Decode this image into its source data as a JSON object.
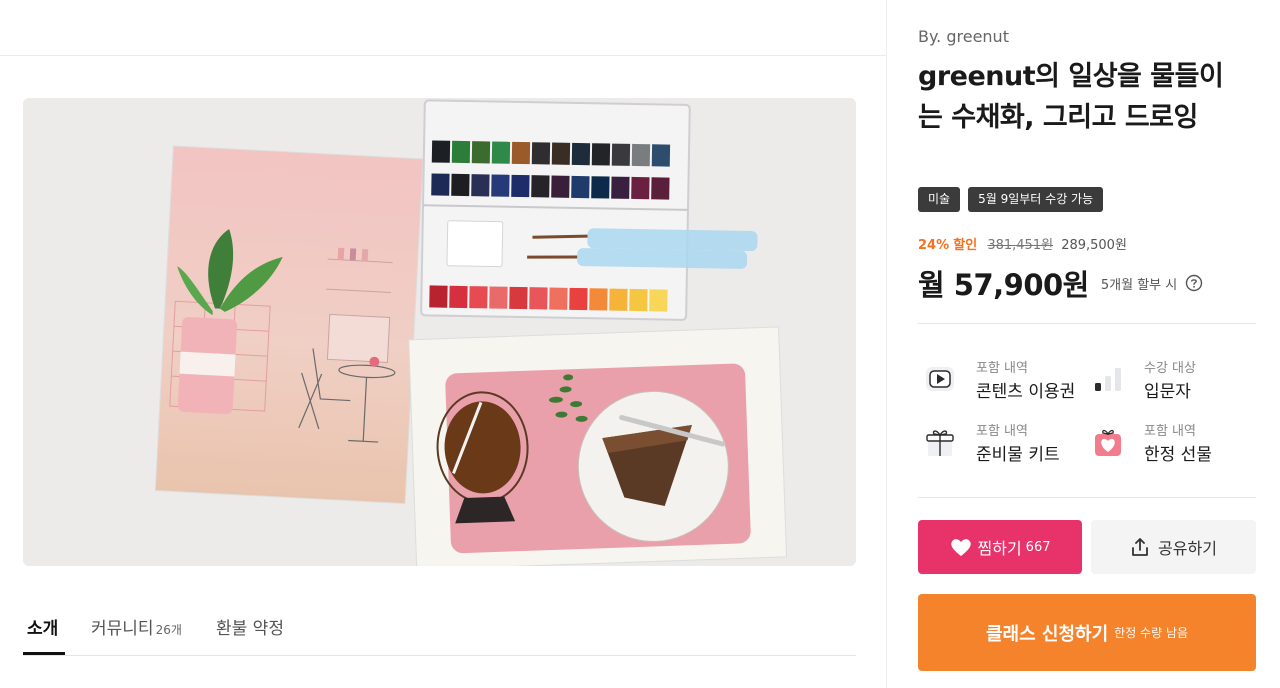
{
  "tabs": [
    {
      "label": "소개",
      "count": ""
    },
    {
      "label": "커뮤니티",
      "count": "26개"
    },
    {
      "label": "환불 약정",
      "count": ""
    }
  ],
  "product": {
    "author": "By. greenut",
    "title": "greenut의 일상을 물들이는 수채화, 그리고 드로잉",
    "tags": [
      "미술",
      "5월 9일부터 수강 가능"
    ]
  },
  "price": {
    "discount_rate": "24%",
    "discount_label": "할인",
    "original": "381,451원",
    "sale": "289,500원",
    "monthly": "월 57,900원",
    "installment_note": "5개월 할부 시"
  },
  "info_items": [
    {
      "label": "포함 내역",
      "value": "콘텐츠 이용권",
      "icon": "play-icon"
    },
    {
      "label": "수강 대상",
      "value": "입문자",
      "icon": "level-bars-icon"
    },
    {
      "label": "포함 내역",
      "value": "준비물 키트",
      "icon": "gift-box-icon"
    },
    {
      "label": "포함 내역",
      "value": "한정 선물",
      "icon": "heart-gift-icon"
    }
  ],
  "actions": {
    "like_label": "찜하기",
    "like_count": "667",
    "share_label": "공유하기",
    "apply_label": "클래스 신청하기",
    "apply_sub": "한정 수량 남음"
  },
  "colors": {
    "accent_orange": "#f5832b",
    "like_pink": "#e8326a",
    "discount_orange": "#f37321",
    "tag_dark": "#3b3b3b"
  }
}
